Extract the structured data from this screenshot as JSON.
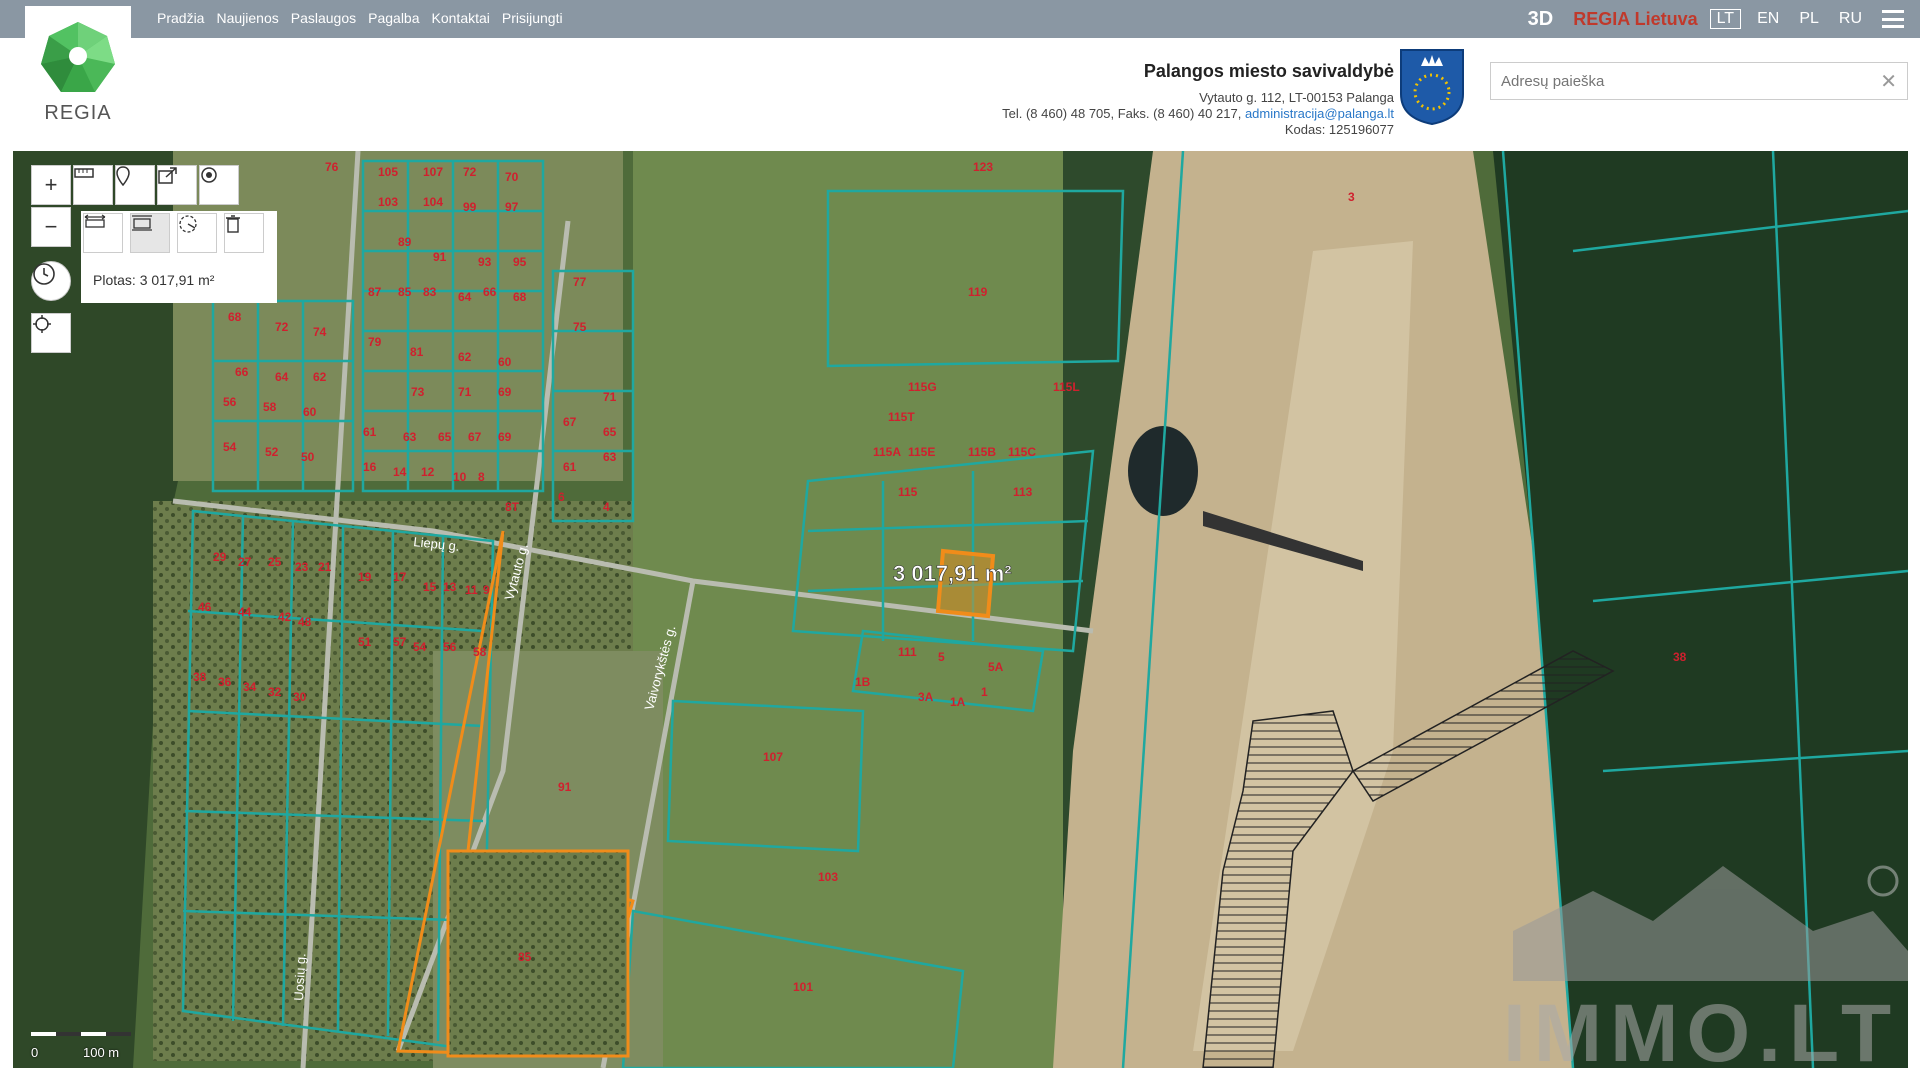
{
  "nav": {
    "items": [
      "Pradžia",
      "Naujienos",
      "Paslaugos",
      "Pagalba",
      "Kontaktai",
      "Prisijungti"
    ]
  },
  "top_right": {
    "btn_3d": "3D",
    "regia_lietuva": "REGIA Lietuva",
    "languages": [
      "LT",
      "EN",
      "PL",
      "RU"
    ],
    "active_language": "LT"
  },
  "logo": {
    "text": "REGIA"
  },
  "organization": {
    "title": "Palangos miesto savivaldybė",
    "address": "Vytauto g. 112, LT-00153 Palanga",
    "contacts": "Tel. (8 460) 48 705, Faks. (8 460) 40 217,",
    "email": "administracija@palanga.lt",
    "code": "Kodas: 125196077"
  },
  "search": {
    "placeholder": "Adresų paieška",
    "value": ""
  },
  "measure": {
    "area_label": "Plotas: 3 017,91 m²",
    "map_area_label": "3 017,91 m²"
  },
  "scale": {
    "zero": "0",
    "distance": "100 m"
  },
  "watermark": "IMMO.LT",
  "colors": {
    "parcel": "#1fa8a0",
    "highlight": "#f08c1a",
    "label": "#d0202e",
    "topbar": "#8a97a3"
  },
  "map_labels": {
    "street_1": "Liepų g.",
    "street_2": "Vaivorykštės g.",
    "street_3": "Vytauto g.",
    "street_4": "Uosių g."
  },
  "parcel_labels": [
    "76",
    "105",
    "107",
    "72",
    "70",
    "103",
    "104",
    "99",
    "97",
    "89",
    "91",
    "93",
    "95",
    "87",
    "85",
    "83",
    "64",
    "66",
    "68",
    "68",
    "72",
    "74",
    "79",
    "81",
    "62",
    "60",
    "77",
    "75",
    "73",
    "71",
    "69",
    "71",
    "66",
    "64",
    "62",
    "56",
    "58",
    "60",
    "61",
    "63",
    "65",
    "67",
    "69",
    "67",
    "65",
    "54",
    "52",
    "50",
    "16",
    "14",
    "12",
    "10",
    "8",
    "61",
    "63",
    "6",
    "4",
    "8T",
    "29",
    "27",
    "25",
    "23",
    "21",
    "19",
    "17",
    "15",
    "13",
    "11",
    "9",
    "46",
    "44",
    "42",
    "48",
    "51",
    "57",
    "54",
    "56",
    "58",
    "38",
    "36",
    "34",
    "32",
    "30",
    "91",
    "107",
    "103",
    "101",
    "85",
    "123",
    "119",
    "115G",
    "115L",
    "115T",
    "115E",
    "115B",
    "115C",
    "115A",
    "115",
    "113",
    "111",
    "5",
    "5A",
    "1",
    "1A",
    "1B",
    "3A",
    "3",
    "38",
    "7"
  ],
  "map_ids": {
    "l1": "42",
    "l2": "40",
    "l3": "38",
    "l4": "36",
    "l5": "34",
    "l6": "32",
    "l7": "30",
    "l8": "28",
    "l9": "26",
    "l10": "24",
    "l11": "22",
    "l12": "20",
    "l13": "18",
    "l14": "16",
    "l15": "14",
    "l16": "12",
    "l17": "10",
    "l18": "8",
    "l19": "6",
    "l20": "4",
    "l21": "2",
    "l22": "1"
  }
}
